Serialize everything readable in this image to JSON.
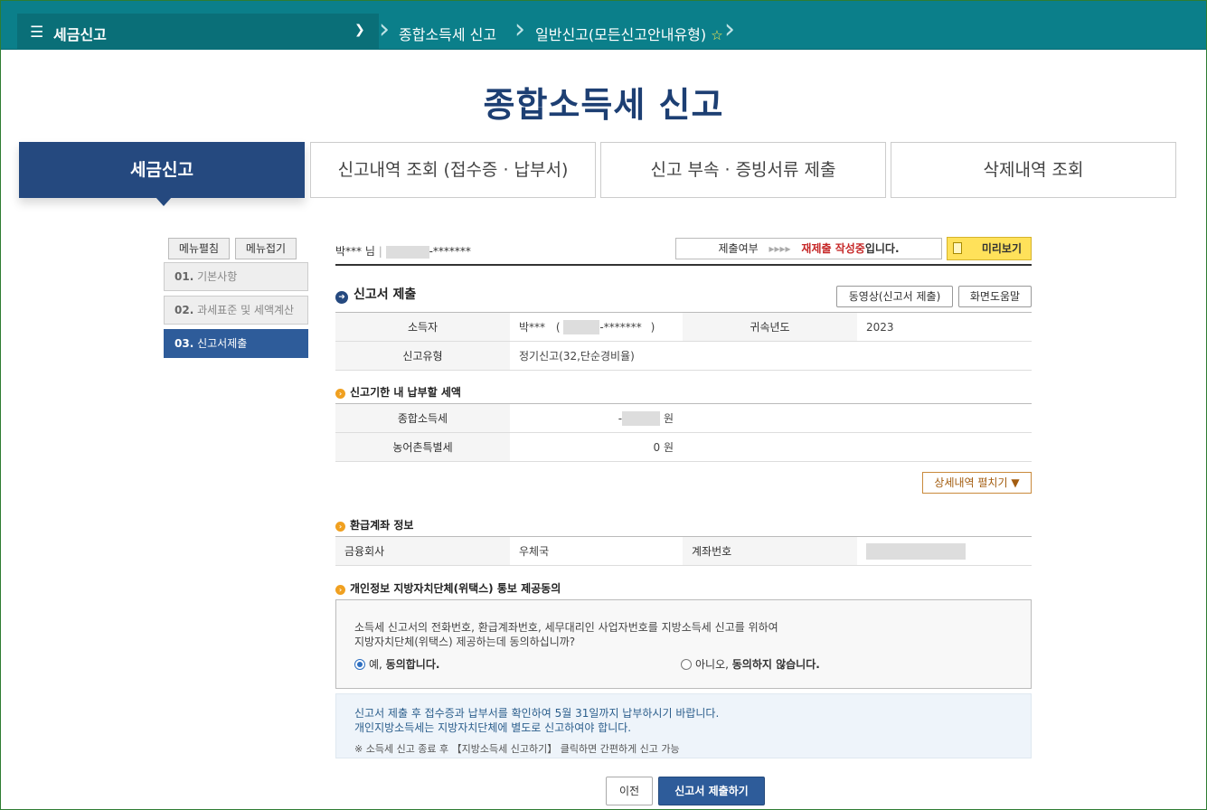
{
  "topbar": {
    "home": "세금신고",
    "crumb1": "종합소득세 신고",
    "crumb2": "일반신고(모든신고안내유형)"
  },
  "page_title": "종합소득세 신고",
  "tabs": [
    "세금신고",
    "신고내역 조회 (접수증 · 납부서)",
    "신고 부속 · 증빙서류 제출",
    "삭제내역 조회"
  ],
  "sidebar": {
    "expand": "메뉴펼침",
    "collapse": "메뉴접기",
    "steps": [
      {
        "num": "01.",
        "label": "기본사항"
      },
      {
        "num": "02.",
        "label": "과세표준 및 세액계산"
      },
      {
        "num": "03.",
        "label": "신고서제출"
      }
    ]
  },
  "user": {
    "name": "박*** 님",
    "id_suffix": "-*******"
  },
  "status": {
    "label": "제출여부",
    "arrows": "▸▸▸▸",
    "value": "재제출 작성중",
    "suffix": "입니다."
  },
  "preview_label": "미리보기",
  "submit_section": {
    "title": "신고서 제출",
    "video_btn": "동영상(신고서 제출)",
    "help_btn": "화면도움말",
    "rows": {
      "taxpayer_label": "소득자",
      "taxpayer_value": "박***",
      "taxpayer_id_open": "(",
      "taxpayer_id": "-*******",
      "taxpayer_id_close": ")",
      "year_label": "귀속년도",
      "year_value": "2023",
      "type_label": "신고유형",
      "type_value": "정기신고(32,단순경비율)"
    }
  },
  "tax_section": {
    "title": "신고기한 내 납부할 세액",
    "income_tax_label": "종합소득세",
    "income_tax_prefix": "-",
    "income_tax_unit": "원",
    "rural_tax_label": "농어촌특별세",
    "rural_tax_value": "0 원",
    "expand_btn": "상세내역 펼치기 ▼"
  },
  "refund_section": {
    "title": "환급계좌 정보",
    "bank_label": "금융회사",
    "bank_value": "우체국",
    "account_label": "계좌번호"
  },
  "consent_section": {
    "title": "개인정보 지방자치단체(위택스) 통보 제공동의",
    "text1": "소득세 신고서의 전화번호, 환급계좌번호, 세무대리인 사업자번호를 지방소득세 신고를 위하여",
    "text2": "지방자치단체(위택스) 제공하는데 동의하십니까?",
    "yes_prefix": "예, ",
    "yes": "동의합니다.",
    "no_prefix": "아니오, ",
    "no": "동의하지 않습니다."
  },
  "notice": {
    "line1": "신고서 제출 후 접수증과 납부서를 확인하여 5월 31일까지 납부하시기 바랍니다.",
    "line2": "개인지방소득세는 지방자치단체에 별도로 신고하여야 합니다.",
    "line3": "※ 소득세 신고 종료 후 【지방소득세 신고하기】 클릭하면 간편하게 신고 가능"
  },
  "buttons": {
    "prev": "이전",
    "submit": "신고서 제출하기"
  }
}
